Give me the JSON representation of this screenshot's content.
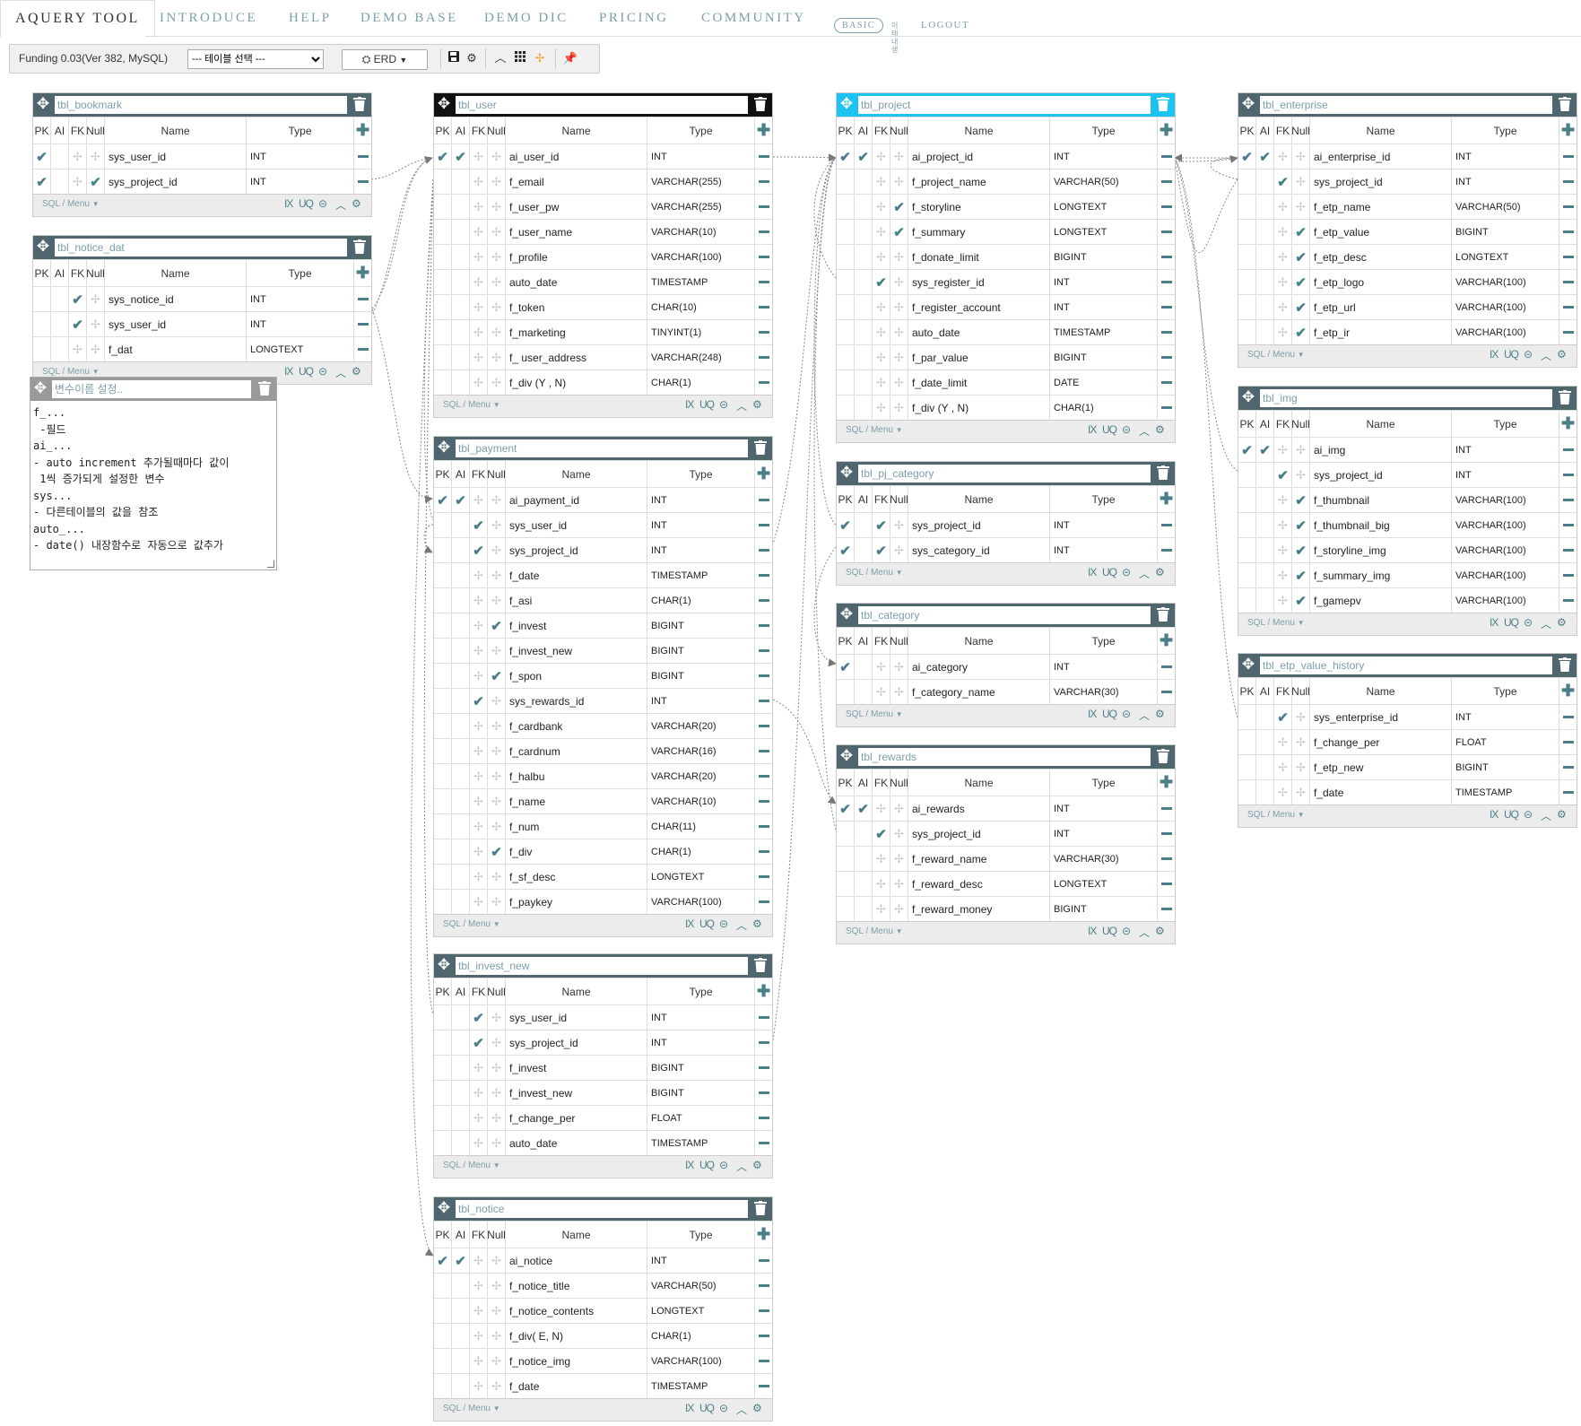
{
  "nav": {
    "tabs": [
      "AQUERY TOOL",
      "INTRODUCE",
      "HELP",
      "DEMO BASE",
      "DEMO DIC",
      "PRICING",
      "COMMUNITY"
    ],
    "badge": "BASIC",
    "user": "이테내생",
    "logout": "LOGOUT"
  },
  "toolbar": {
    "db_label": "Funding 0.03(Ver 382, MySQL)",
    "table_select": "--- 테이블 선택 ---",
    "erd_label": "ERD"
  },
  "headers": {
    "pk": "PK",
    "ai": "AI",
    "fk": "FK",
    "nl": "Null",
    "name": "Name",
    "type": "Type"
  },
  "footer": {
    "sql": "SQL / Menu",
    "ix": "IX",
    "uq": "UQ"
  },
  "memo": {
    "placeholder": "변수이름 설정..",
    "text": "f_...\n -필드\nai_...\n- auto increment 추가될때마다 값이\n 1씩 증가되게 설정한 변수\nsys...\n- 다른테이블의 값을 참조\nauto_...\n- date() 내장함수로 자동으로 값추가"
  },
  "tables": [
    {
      "id": "bookmark",
      "name": "tbl_bookmark",
      "cols": [
        {
          "pk": 1,
          "ai": 0,
          "fk": 0,
          "nl": 0,
          "name": "sys_user_id",
          "type": "INT"
        },
        {
          "pk": 1,
          "ai": 0,
          "fk": 0,
          "nl": 1,
          "name": "sys_project_id",
          "type": "INT"
        }
      ]
    },
    {
      "id": "notice_dat",
      "name": "tbl_notice_dat",
      "cols": [
        {
          "pk": 0,
          "ai": 0,
          "fk": 1,
          "nl": 0,
          "name": "sys_notice_id",
          "type": "INT"
        },
        {
          "pk": 0,
          "ai": 0,
          "fk": 1,
          "nl": 0,
          "name": "sys_user_id",
          "type": "INT"
        },
        {
          "pk": 0,
          "ai": 0,
          "fk": 0,
          "nl": 0,
          "name": "f_dat",
          "type": "LONGTEXT"
        }
      ]
    },
    {
      "id": "user",
      "name": "tbl_user",
      "cols": [
        {
          "pk": 1,
          "ai": 1,
          "fk": 0,
          "nl": 0,
          "name": "ai_user_id",
          "type": "INT"
        },
        {
          "pk": 0,
          "ai": 0,
          "fk": 0,
          "nl": 0,
          "name": "f_email",
          "type": "VARCHAR(255)"
        },
        {
          "pk": 0,
          "ai": 0,
          "fk": 0,
          "nl": 0,
          "name": "f_user_pw",
          "type": "VARCHAR(255)"
        },
        {
          "pk": 0,
          "ai": 0,
          "fk": 0,
          "nl": 0,
          "name": "f_user_name",
          "type": "VARCHAR(10)"
        },
        {
          "pk": 0,
          "ai": 0,
          "fk": 0,
          "nl": 0,
          "name": "f_profile",
          "type": "VARCHAR(100)"
        },
        {
          "pk": 0,
          "ai": 0,
          "fk": 0,
          "nl": 0,
          "name": "auto_date",
          "type": "TIMESTAMP"
        },
        {
          "pk": 0,
          "ai": 0,
          "fk": 0,
          "nl": 0,
          "name": "f_token",
          "type": "CHAR(10)"
        },
        {
          "pk": 0,
          "ai": 0,
          "fk": 0,
          "nl": 0,
          "name": "f_marketing",
          "type": "TINYINT(1)"
        },
        {
          "pk": 0,
          "ai": 0,
          "fk": 0,
          "nl": 0,
          "name": "f_ user_address",
          "type": "VARCHAR(248)"
        },
        {
          "pk": 0,
          "ai": 0,
          "fk": 0,
          "nl": 0,
          "name": "f_div (Y , N)",
          "type": "CHAR(1)"
        }
      ]
    },
    {
      "id": "payment",
      "name": "tbl_payment",
      "cols": [
        {
          "pk": 1,
          "ai": 1,
          "fk": 0,
          "nl": 0,
          "name": "ai_payment_id",
          "type": "INT"
        },
        {
          "pk": 0,
          "ai": 0,
          "fk": 1,
          "nl": 0,
          "name": "sys_user_id",
          "type": "INT"
        },
        {
          "pk": 0,
          "ai": 0,
          "fk": 1,
          "nl": 0,
          "name": "sys_project_id",
          "type": "INT"
        },
        {
          "pk": 0,
          "ai": 0,
          "fk": 0,
          "nl": 0,
          "name": "f_date",
          "type": "TIMESTAMP"
        },
        {
          "pk": 0,
          "ai": 0,
          "fk": 0,
          "nl": 0,
          "name": "f_asi",
          "type": "CHAR(1)"
        },
        {
          "pk": 0,
          "ai": 0,
          "fk": 0,
          "nl": 1,
          "name": "f_invest",
          "type": "BIGINT"
        },
        {
          "pk": 0,
          "ai": 0,
          "fk": 0,
          "nl": 0,
          "name": "f_invest_new",
          "type": "BIGINT"
        },
        {
          "pk": 0,
          "ai": 0,
          "fk": 0,
          "nl": 1,
          "name": "f_spon",
          "type": "BIGINT"
        },
        {
          "pk": 0,
          "ai": 0,
          "fk": 1,
          "nl": 0,
          "name": "sys_rewards_id",
          "type": "INT"
        },
        {
          "pk": 0,
          "ai": 0,
          "fk": 0,
          "nl": 0,
          "name": "f_cardbank",
          "type": "VARCHAR(20)"
        },
        {
          "pk": 0,
          "ai": 0,
          "fk": 0,
          "nl": 0,
          "name": "f_cardnum",
          "type": "VARCHAR(16)"
        },
        {
          "pk": 0,
          "ai": 0,
          "fk": 0,
          "nl": 0,
          "name": "f_halbu",
          "type": "VARCHAR(20)"
        },
        {
          "pk": 0,
          "ai": 0,
          "fk": 0,
          "nl": 0,
          "name": "f_name",
          "type": "VARCHAR(10)"
        },
        {
          "pk": 0,
          "ai": 0,
          "fk": 0,
          "nl": 0,
          "name": "f_num",
          "type": "CHAR(11)"
        },
        {
          "pk": 0,
          "ai": 0,
          "fk": 0,
          "nl": 1,
          "name": "f_div",
          "type": "CHAR(1)"
        },
        {
          "pk": 0,
          "ai": 0,
          "fk": 0,
          "nl": 0,
          "name": "f_sf_desc",
          "type": "LONGTEXT"
        },
        {
          "pk": 0,
          "ai": 0,
          "fk": 0,
          "nl": 0,
          "name": "f_paykey",
          "type": "VARCHAR(100)"
        }
      ]
    },
    {
      "id": "invest_new",
      "name": "tbl_invest_new",
      "cols": [
        {
          "pk": 0,
          "ai": 0,
          "fk": 1,
          "nl": 0,
          "name": "sys_user_id",
          "type": "INT"
        },
        {
          "pk": 0,
          "ai": 0,
          "fk": 1,
          "nl": 0,
          "name": "sys_project_id",
          "type": "INT"
        },
        {
          "pk": 0,
          "ai": 0,
          "fk": 0,
          "nl": 0,
          "name": "f_invest",
          "type": "BIGINT"
        },
        {
          "pk": 0,
          "ai": 0,
          "fk": 0,
          "nl": 0,
          "name": "f_invest_new",
          "type": "BIGINT"
        },
        {
          "pk": 0,
          "ai": 0,
          "fk": 0,
          "nl": 0,
          "name": "f_change_per",
          "type": "FLOAT"
        },
        {
          "pk": 0,
          "ai": 0,
          "fk": 0,
          "nl": 0,
          "name": "auto_date",
          "type": "TIMESTAMP"
        }
      ]
    },
    {
      "id": "notice",
      "name": "tbl_notice",
      "cols": [
        {
          "pk": 1,
          "ai": 1,
          "fk": 0,
          "nl": 0,
          "name": "ai_notice",
          "type": "INT"
        },
        {
          "pk": 0,
          "ai": 0,
          "fk": 0,
          "nl": 0,
          "name": "f_notice_title",
          "type": "VARCHAR(50)"
        },
        {
          "pk": 0,
          "ai": 0,
          "fk": 0,
          "nl": 0,
          "name": "f_notice_contents",
          "type": "LONGTEXT"
        },
        {
          "pk": 0,
          "ai": 0,
          "fk": 0,
          "nl": 0,
          "name": "f_div( E, N)",
          "type": "CHAR(1)"
        },
        {
          "pk": 0,
          "ai": 0,
          "fk": 0,
          "nl": 0,
          "name": "f_notice_img",
          "type": "VARCHAR(100)"
        },
        {
          "pk": 0,
          "ai": 0,
          "fk": 0,
          "nl": 0,
          "name": "f_date",
          "type": "TIMESTAMP"
        }
      ]
    },
    {
      "id": "project",
      "name": "tbl_project",
      "cols": [
        {
          "pk": 1,
          "ai": 1,
          "fk": 0,
          "nl": 0,
          "name": "ai_project_id",
          "type": "INT"
        },
        {
          "pk": 0,
          "ai": 0,
          "fk": 0,
          "nl": 0,
          "name": "f_project_name",
          "type": "VARCHAR(50)"
        },
        {
          "pk": 0,
          "ai": 0,
          "fk": 0,
          "nl": 1,
          "name": "f_storyline",
          "type": "LONGTEXT"
        },
        {
          "pk": 0,
          "ai": 0,
          "fk": 0,
          "nl": 1,
          "name": "f_summary",
          "type": "LONGTEXT"
        },
        {
          "pk": 0,
          "ai": 0,
          "fk": 0,
          "nl": 0,
          "name": "f_donate_limit",
          "type": "BIGINT"
        },
        {
          "pk": 0,
          "ai": 0,
          "fk": 1,
          "nl": 0,
          "name": "sys_register_id",
          "type": "INT"
        },
        {
          "pk": 0,
          "ai": 0,
          "fk": 0,
          "nl": 0,
          "name": "f_register_account",
          "type": "INT"
        },
        {
          "pk": 0,
          "ai": 0,
          "fk": 0,
          "nl": 0,
          "name": "auto_date",
          "type": "TIMESTAMP"
        },
        {
          "pk": 0,
          "ai": 0,
          "fk": 0,
          "nl": 0,
          "name": "f_par_value",
          "type": "BIGINT"
        },
        {
          "pk": 0,
          "ai": 0,
          "fk": 0,
          "nl": 0,
          "name": "f_date_limit",
          "type": "DATE"
        },
        {
          "pk": 0,
          "ai": 0,
          "fk": 0,
          "nl": 0,
          "name": "f_div (Y , N)",
          "type": "CHAR(1)"
        }
      ]
    },
    {
      "id": "pj_category",
      "name": "tbl_pj_category",
      "cols": [
        {
          "pk": 1,
          "ai": 0,
          "fk": 1,
          "nl": 0,
          "name": "sys_project_id",
          "type": "INT"
        },
        {
          "pk": 1,
          "ai": 0,
          "fk": 1,
          "nl": 0,
          "name": "sys_category_id",
          "type": "INT"
        }
      ]
    },
    {
      "id": "category",
      "name": "tbl_category",
      "cols": [
        {
          "pk": 1,
          "ai": 0,
          "fk": 0,
          "nl": 0,
          "name": "ai_category",
          "type": "INT"
        },
        {
          "pk": 0,
          "ai": 0,
          "fk": 0,
          "nl": 0,
          "name": "f_category_name",
          "type": "VARCHAR(30)"
        }
      ]
    },
    {
      "id": "rewards",
      "name": "tbl_rewards",
      "cols": [
        {
          "pk": 1,
          "ai": 1,
          "fk": 0,
          "nl": 0,
          "name": "ai_rewards",
          "type": "INT"
        },
        {
          "pk": 0,
          "ai": 0,
          "fk": 1,
          "nl": 0,
          "name": "sys_project_id",
          "type": "INT"
        },
        {
          "pk": 0,
          "ai": 0,
          "fk": 0,
          "nl": 0,
          "name": "f_reward_name",
          "type": "VARCHAR(30)"
        },
        {
          "pk": 0,
          "ai": 0,
          "fk": 0,
          "nl": 0,
          "name": "f_reward_desc",
          "type": "LONGTEXT"
        },
        {
          "pk": 0,
          "ai": 0,
          "fk": 0,
          "nl": 0,
          "name": "f_reward_money",
          "type": "BIGINT"
        }
      ]
    },
    {
      "id": "enterprise",
      "name": "tbl_enterprise",
      "cols": [
        {
          "pk": 1,
          "ai": 1,
          "fk": 0,
          "nl": 0,
          "name": "ai_enterprise_id",
          "type": "INT"
        },
        {
          "pk": 0,
          "ai": 0,
          "fk": 1,
          "nl": 0,
          "name": "sys_project_id",
          "type": "INT"
        },
        {
          "pk": 0,
          "ai": 0,
          "fk": 0,
          "nl": 0,
          "name": "f_etp_name",
          "type": "VARCHAR(50)"
        },
        {
          "pk": 0,
          "ai": 0,
          "fk": 0,
          "nl": 1,
          "name": "f_etp_value",
          "type": "BIGINT"
        },
        {
          "pk": 0,
          "ai": 0,
          "fk": 0,
          "nl": 1,
          "name": "f_etp_desc",
          "type": "LONGTEXT"
        },
        {
          "pk": 0,
          "ai": 0,
          "fk": 0,
          "nl": 1,
          "name": "f_etp_logo",
          "type": "VARCHAR(100)"
        },
        {
          "pk": 0,
          "ai": 0,
          "fk": 0,
          "nl": 1,
          "name": "f_etp_url",
          "type": "VARCHAR(100)"
        },
        {
          "pk": 0,
          "ai": 0,
          "fk": 0,
          "nl": 1,
          "name": "f_etp_ir",
          "type": "VARCHAR(100)"
        }
      ]
    },
    {
      "id": "img",
      "name": "tbl_img",
      "cols": [
        {
          "pk": 1,
          "ai": 1,
          "fk": 0,
          "nl": 0,
          "name": "ai_img",
          "type": "INT"
        },
        {
          "pk": 0,
          "ai": 0,
          "fk": 1,
          "nl": 0,
          "name": "sys_project_id",
          "type": "INT"
        },
        {
          "pk": 0,
          "ai": 0,
          "fk": 0,
          "nl": 1,
          "name": "f_thumbnail",
          "type": "VARCHAR(100)"
        },
        {
          "pk": 0,
          "ai": 0,
          "fk": 0,
          "nl": 1,
          "name": "f_thumbnail_big",
          "type": "VARCHAR(100)"
        },
        {
          "pk": 0,
          "ai": 0,
          "fk": 0,
          "nl": 1,
          "name": "f_storyline_img",
          "type": "VARCHAR(100)"
        },
        {
          "pk": 0,
          "ai": 0,
          "fk": 0,
          "nl": 1,
          "name": "f_summary_img",
          "type": "VARCHAR(100)"
        },
        {
          "pk": 0,
          "ai": 0,
          "fk": 0,
          "nl": 1,
          "name": "f_gamepv",
          "type": "VARCHAR(100)"
        }
      ]
    },
    {
      "id": "etp_value_history",
      "name": "tbl_etp_value_history",
      "cols": [
        {
          "pk": 0,
          "ai": 0,
          "fk": 1,
          "nl": 0,
          "name": "sys_enterprise_id",
          "type": "INT"
        },
        {
          "pk": 0,
          "ai": 0,
          "fk": 0,
          "nl": 0,
          "name": "f_change_per",
          "type": "FLOAT"
        },
        {
          "pk": 0,
          "ai": 0,
          "fk": 0,
          "nl": 0,
          "name": "f_etp_new",
          "type": "BIGINT"
        },
        {
          "pk": 0,
          "ai": 0,
          "fk": 0,
          "nl": 0,
          "name": "f_date",
          "type": "TIMESTAMP"
        }
      ]
    }
  ]
}
